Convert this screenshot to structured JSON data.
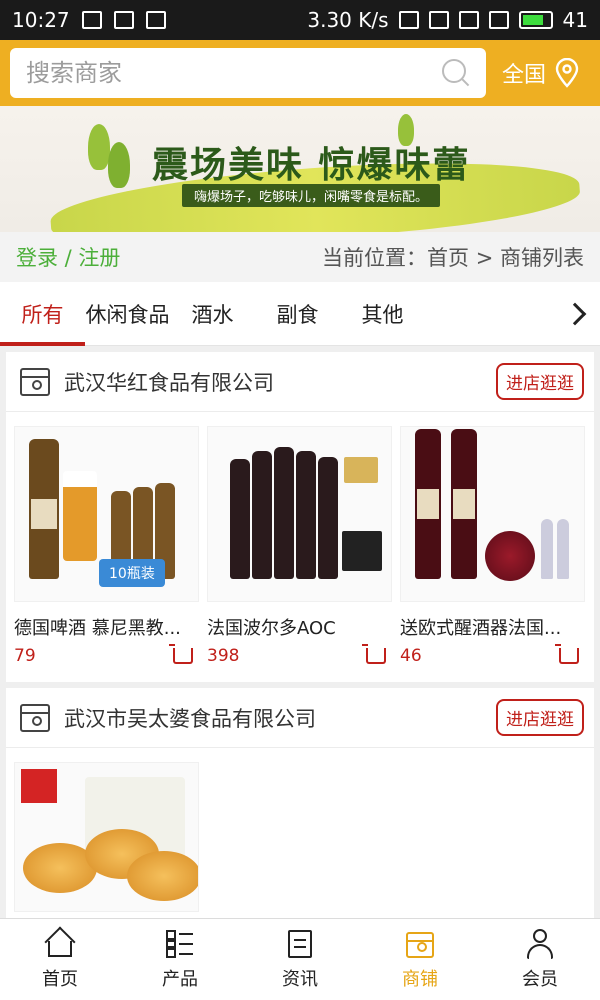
{
  "status_bar": {
    "time": "10:27",
    "speed": "3.30 K/s",
    "battery": "41"
  },
  "search": {
    "placeholder": "搜索商家"
  },
  "region": {
    "label": "全国"
  },
  "banner": {
    "title": "震场美味 惊爆味蕾",
    "slogan": "嗨爆场子，吃够味儿，闲嘴零食是标配。"
  },
  "login": {
    "label": "登录 / 注册"
  },
  "breadcrumb": {
    "text": "当前位置：首页 > 商铺列表"
  },
  "tabs": [
    {
      "label": "所有"
    },
    {
      "label": "休闲食品"
    },
    {
      "label": "酒水"
    },
    {
      "label": "副食"
    },
    {
      "label": "其他"
    }
  ],
  "shops": [
    {
      "name": "武汉华红食品有限公司",
      "visit_label": "进店逛逛",
      "products": [
        {
          "name": "德国啤酒 慕尼黑教...",
          "price": "79",
          "badge": "10瓶装"
        },
        {
          "name": "法国波尔多AOC",
          "price": "398"
        },
        {
          "name": "送欧式醒酒器法国...",
          "price": "46"
        }
      ]
    },
    {
      "name": "武汉市吴太婆食品有限公司",
      "visit_label": "进店逛逛"
    }
  ],
  "bottom_nav": [
    {
      "label": "首页",
      "icon": "home-icon"
    },
    {
      "label": "产品",
      "icon": "grid-icon"
    },
    {
      "label": "资讯",
      "icon": "news-icon"
    },
    {
      "label": "商铺",
      "icon": "store-icon"
    },
    {
      "label": "会员",
      "icon": "user-icon"
    }
  ],
  "colors": {
    "header": "#eeaf22",
    "accent_red": "#c0201a",
    "active_nav": "#e6a516",
    "login_green": "#4caf3a"
  }
}
